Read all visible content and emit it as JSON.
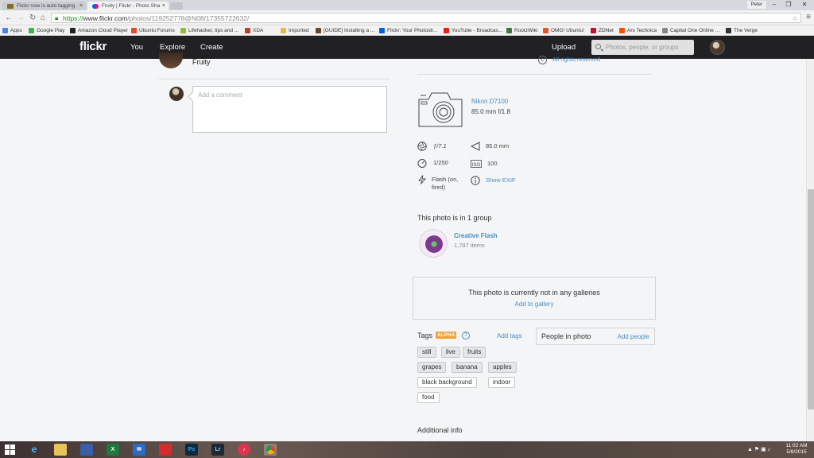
{
  "browser": {
    "tabs": [
      {
        "title": "Flickr now is auto tagging",
        "active": false
      },
      {
        "title": "Fruity | Flickr - Photo Sha",
        "active": true
      }
    ],
    "profile": "Peter",
    "url": {
      "scheme": "https://",
      "host": "www.flickr.com",
      "path": "/photos/119252778@N08/17355722632/"
    },
    "bookmarks": [
      "Apps",
      "Google Play",
      "Amazon Cloud Player",
      "Ubuntu Forums",
      "Lifehacker, tips and ...",
      "XDA",
      "Imported",
      "[GUIDE] Installing a ...",
      "Flickr: Your Photostr...",
      "YouTube - Broadcas...",
      "RootzWiki",
      "OMG! Ubuntu!",
      "ZDNet",
      "Ars Technica",
      "Capital One Online ...",
      "The Verge"
    ]
  },
  "flickr_header": {
    "logo": "flickr",
    "nav": [
      "You",
      "Explore",
      "Create"
    ],
    "upload": "Upload",
    "search_placeholder": "Photos, people, or groups"
  },
  "photo": {
    "title": "Fruity",
    "rights": "All rights reserved",
    "comment_placeholder": "Add a comment"
  },
  "camera": {
    "model": "Nikon D7100",
    "lens": "85.0 mm f/1.8",
    "aperture": "ƒ/7.1",
    "focal_length": "85.0 mm",
    "shutter": "1/250",
    "iso": "100",
    "flash": "Flash (on, fired)",
    "show_exif": "Show EXIF"
  },
  "groups": {
    "heading": "This photo is in 1 group",
    "items": [
      {
        "name": "Creative Flash",
        "count": "1,787 items"
      }
    ]
  },
  "galleries": {
    "message": "This photo is currently not in any galleries",
    "add": "Add to gallery"
  },
  "tags": {
    "heading": "Tags",
    "badge": "ALPHA",
    "add": "Add tags",
    "items": [
      {
        "label": "still",
        "auto": true
      },
      {
        "label": "live",
        "auto": true
      },
      {
        "label": "fruits",
        "auto": true
      },
      {
        "label": "grapes",
        "auto": true
      },
      {
        "label": "banana",
        "auto": true
      },
      {
        "label": "apples",
        "auto": true
      },
      {
        "label": "black background",
        "auto": false
      },
      {
        "label": "indoor",
        "auto": false
      },
      {
        "label": "food",
        "auto": false
      }
    ]
  },
  "people": {
    "heading": "People in photo",
    "add": "Add people"
  },
  "additional_info": "Additional info",
  "taskbar": {
    "time": "11:02 AM",
    "date": "5/8/2015"
  },
  "colors": {
    "link": "#4a8ec2",
    "header_bg": "#212124",
    "alpha_badge": "#f0a23a"
  }
}
